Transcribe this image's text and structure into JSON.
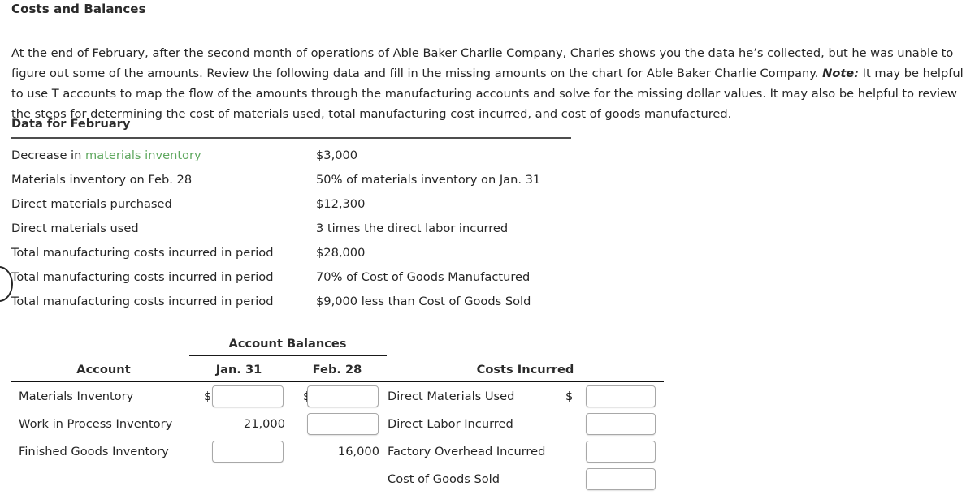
{
  "page_title": "Costs and Balances",
  "intro": {
    "part1": "At the end of February, after the second month of operations of Able Baker Charlie Company, Charles shows you the data he’s collected, but he was unable to figure out some of the amounts. Review the following data and fill in the missing amounts on the chart for Able Baker Charlie Company. ",
    "note_label": "Note:",
    "part2": " It may be helpful to use T accounts to map the flow of the amounts through the manufacturing accounts and solve for the missing dollar values. It may also be helpful to review the steps for determining the cost of materials used, total manufacturing cost incurred, and cost of goods manufactured."
  },
  "data_section": {
    "title": "Data for February",
    "rows": [
      {
        "label_prefix": "Decrease in ",
        "label_link": "materials inventory",
        "label_suffix": "",
        "value": "$3,000"
      },
      {
        "label_prefix": "Materials inventory on Feb. 28",
        "label_link": "",
        "label_suffix": "",
        "value": "50% of materials inventory on Jan. 31"
      },
      {
        "label_prefix": "Direct materials purchased",
        "label_link": "",
        "label_suffix": "",
        "value": "$12,300"
      },
      {
        "label_prefix": "Direct materials used",
        "label_link": "",
        "label_suffix": "",
        "value": "3 times the direct labor incurred"
      },
      {
        "label_prefix": "Total manufacturing costs incurred in period",
        "label_link": "",
        "label_suffix": "",
        "value": "$28,000"
      },
      {
        "label_prefix": "Total manufacturing costs incurred in period",
        "label_link": "",
        "label_suffix": "",
        "value": "70% of Cost of Goods Manufactured"
      },
      {
        "label_prefix": "Total manufacturing costs incurred in period",
        "label_link": "",
        "label_suffix": "",
        "value": "$9,000 less than Cost of Goods Sold"
      }
    ]
  },
  "balances": {
    "group_header": "Account Balances",
    "col_account": "Account",
    "col_jan": "Jan. 31",
    "col_feb": "Feb. 28",
    "col_costs": "Costs Incurred",
    "dollar_sign": "$",
    "rows": [
      {
        "account": "Materials Inventory",
        "account_green": false,
        "jan_type": "input",
        "jan_dollar": true,
        "jan_value": "",
        "feb_type": "input",
        "feb_dollar": true,
        "feb_value": "",
        "cost_label": "Direct Materials Used",
        "cost_type": "input",
        "cost_dollar": true,
        "cost_value": ""
      },
      {
        "account": "Work in Process Inventory",
        "account_green": true,
        "jan_type": "text",
        "jan_dollar": false,
        "jan_value": "21,000",
        "feb_type": "input",
        "feb_dollar": false,
        "feb_value": "",
        "cost_label": "Direct Labor Incurred",
        "cost_type": "input",
        "cost_dollar": false,
        "cost_value": ""
      },
      {
        "account": "Finished Goods Inventory",
        "account_green": true,
        "jan_type": "input",
        "jan_dollar": false,
        "jan_value": "",
        "feb_type": "text",
        "feb_dollar": false,
        "feb_value": "16,000",
        "cost_label": "Factory Overhead Incurred",
        "cost_type": "input",
        "cost_dollar": false,
        "cost_value": ""
      },
      {
        "account": "",
        "account_green": false,
        "jan_type": "none",
        "jan_dollar": false,
        "jan_value": "",
        "feb_type": "none",
        "feb_dollar": false,
        "feb_value": "",
        "cost_label": "Cost of Goods Sold",
        "cost_type": "input",
        "cost_dollar": false,
        "cost_value": ""
      }
    ]
  },
  "colors": {
    "link_green": "#5fa85f",
    "text": "#262626",
    "rule": "#111111"
  }
}
